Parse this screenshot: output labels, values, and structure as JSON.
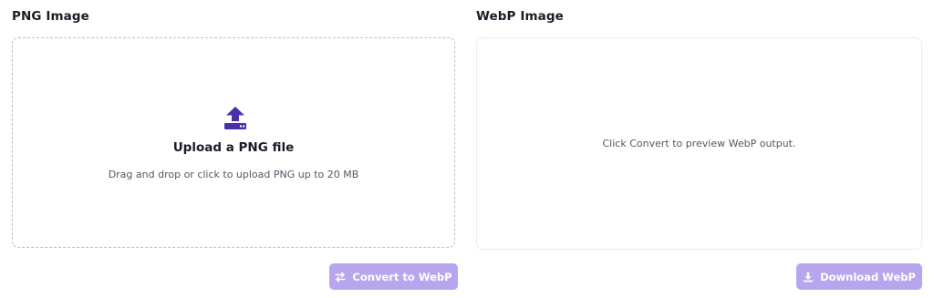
{
  "png_panel": {
    "title": "PNG Image",
    "upload_title": "Upload a PNG file",
    "upload_hint": "Drag and drop or click to upload PNG up to 20 MB",
    "upload_icon": "upload-icon"
  },
  "webp_panel": {
    "title": "WebP Image",
    "preview_message": "Click Convert to preview WebP output."
  },
  "actions": {
    "convert_label": "Convert to WebP",
    "convert_icon": "swap-arrows-icon",
    "download_label": "Download WebP",
    "download_icon": "download-icon"
  },
  "colors": {
    "accent": "#4b2fa8",
    "button_disabled": "#b7a6ee",
    "button_text": "#ffffff"
  }
}
